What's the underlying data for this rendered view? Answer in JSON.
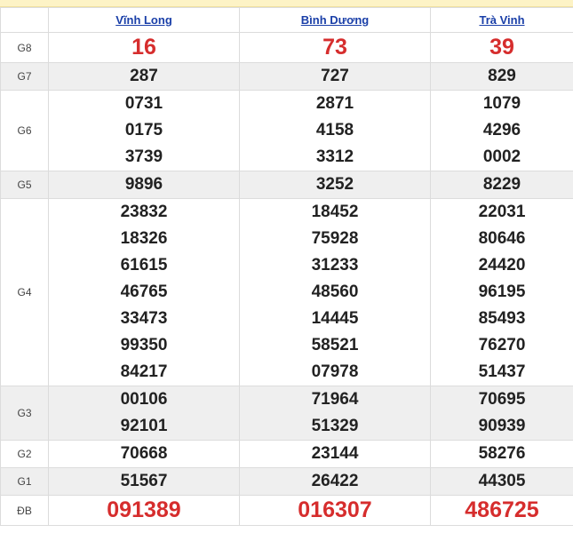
{
  "provinces": [
    "Vĩnh Long",
    "Bình Dương",
    "Trà Vinh"
  ],
  "rows": [
    {
      "label": "G8",
      "values": [
        [
          "16"
        ],
        [
          "73"
        ],
        [
          "39"
        ]
      ]
    },
    {
      "label": "G7",
      "values": [
        [
          "287"
        ],
        [
          "727"
        ],
        [
          "829"
        ]
      ]
    },
    {
      "label": "G6",
      "values": [
        [
          "0731",
          "0175",
          "3739"
        ],
        [
          "2871",
          "4158",
          "3312"
        ],
        [
          "1079",
          "4296",
          "0002"
        ]
      ]
    },
    {
      "label": "G5",
      "values": [
        [
          "9896"
        ],
        [
          "3252"
        ],
        [
          "8229"
        ]
      ]
    },
    {
      "label": "G4",
      "values": [
        [
          "23832",
          "18326",
          "61615",
          "46765",
          "33473",
          "99350",
          "84217"
        ],
        [
          "18452",
          "75928",
          "31233",
          "48560",
          "14445",
          "58521",
          "07978"
        ],
        [
          "22031",
          "80646",
          "24420",
          "96195",
          "85493",
          "76270",
          "51437"
        ]
      ]
    },
    {
      "label": "G3",
      "values": [
        [
          "00106",
          "92101"
        ],
        [
          "71964",
          "51329"
        ],
        [
          "70695",
          "90939"
        ]
      ]
    },
    {
      "label": "G2",
      "values": [
        [
          "70668"
        ],
        [
          "23144"
        ],
        [
          "58276"
        ]
      ]
    },
    {
      "label": "G1",
      "values": [
        [
          "51567"
        ],
        [
          "26422"
        ],
        [
          "44305"
        ]
      ]
    },
    {
      "label": "ĐB",
      "values": [
        [
          "091389"
        ],
        [
          "016307"
        ],
        [
          "486725"
        ]
      ]
    }
  ],
  "colors": {
    "header_link": "#1a3fa8",
    "highlight_red": "#d62d2d",
    "shade": "#efefef"
  }
}
